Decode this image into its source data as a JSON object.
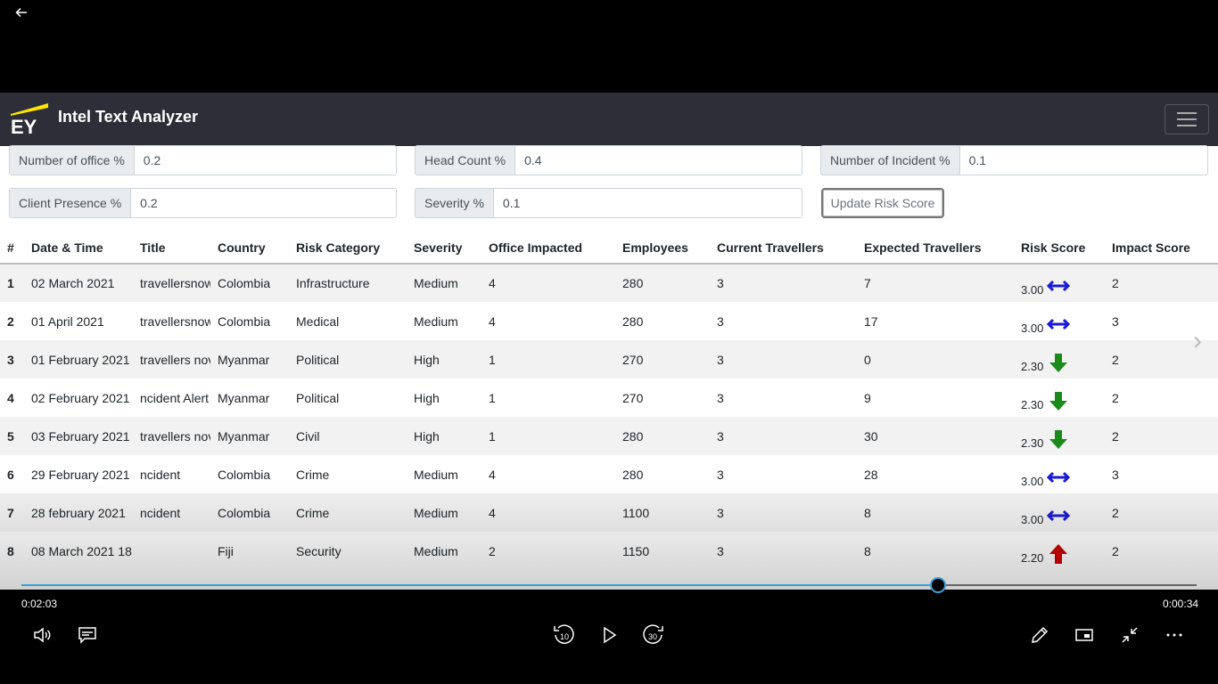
{
  "player": {
    "elapsed": "0:02:03",
    "remaining": "0:00:34",
    "progress_fraction": 0.78,
    "skip_back_label": "10",
    "skip_forward_label": "30"
  },
  "app": {
    "logo_text": "EY",
    "title": "Intel Text Analyzer"
  },
  "weights": [
    {
      "label": "Number of office %",
      "value": "0.2"
    },
    {
      "label": "Head Count %",
      "value": "0.4"
    },
    {
      "label": "Number of Incident %",
      "value": "0.1"
    },
    {
      "label": "Client Presence %",
      "value": "0.2"
    },
    {
      "label": "Severity %",
      "value": "0.1"
    }
  ],
  "update_button": "Update Risk Score",
  "table": {
    "headers": [
      "#",
      "Date & Time",
      "Title",
      "Country",
      "Risk Category",
      "Severity",
      "Office Impacted",
      "Employees",
      "Current Travellers",
      "Expected Travellers",
      "Risk Score",
      "Impact Score"
    ],
    "rows": [
      {
        "idx": "1",
        "date": "02 March 2021",
        "title": "travellersnow",
        "country": "Colombia",
        "category": "Infrastructure",
        "severity": "Medium",
        "office": "4",
        "employees": "280",
        "current": "3",
        "expected": "7",
        "risk": "3.00",
        "trend": "flat",
        "impact": "2"
      },
      {
        "idx": "2",
        "date": "01 April 2021",
        "title": "travellersnow",
        "country": "Colombia",
        "category": "Medical",
        "severity": "Medium",
        "office": "4",
        "employees": "280",
        "current": "3",
        "expected": "17",
        "risk": "3.00",
        "trend": "flat",
        "impact": "3"
      },
      {
        "idx": "3",
        "date": "01 February 2021",
        "title": "travellers nov",
        "country": "Myanmar",
        "category": "Political",
        "severity": "High",
        "office": "1",
        "employees": "270",
        "current": "3",
        "expected": "0",
        "risk": "2.30",
        "trend": "down",
        "impact": "2"
      },
      {
        "idx": "4",
        "date": "02 February 2021",
        "title": "ncident Alert",
        "country": "Myanmar",
        "category": "Political",
        "severity": "High",
        "office": "1",
        "employees": "270",
        "current": "3",
        "expected": "9",
        "risk": "2.30",
        "trend": "down",
        "impact": "2"
      },
      {
        "idx": "5",
        "date": "03 February 2021 :",
        "title": "travellers nov",
        "country": "Myanmar",
        "category": "Civil",
        "severity": "High",
        "office": "1",
        "employees": "280",
        "current": "3",
        "expected": "30",
        "risk": "2.30",
        "trend": "down",
        "impact": "2"
      },
      {
        "idx": "6",
        "date": "29 February 2021",
        "title": "ncident",
        "country": "Colombia",
        "category": "Crime",
        "severity": "Medium",
        "office": "4",
        "employees": "280",
        "current": "3",
        "expected": "28",
        "risk": "3.00",
        "trend": "flat",
        "impact": "3"
      },
      {
        "idx": "7",
        "date": "28 february 2021",
        "title": "ncident",
        "country": "Colombia",
        "category": "Crime",
        "severity": "Medium",
        "office": "4",
        "employees": "1100",
        "current": "3",
        "expected": "8",
        "risk": "3.00",
        "trend": "flat",
        "impact": "2"
      },
      {
        "idx": "8",
        "date": "08 March 2021 18:",
        "title": "",
        "country": "Fiji",
        "category": "Security",
        "severity": "Medium",
        "office": "2",
        "employees": "1150",
        "current": "3",
        "expected": "8",
        "risk": "2.20",
        "trend": "up",
        "impact": "2"
      }
    ]
  },
  "colors": {
    "navbar": "#2e2e38",
    "logo_yellow": "#ffe600",
    "trend_flat": "#1a1ad6",
    "trend_down": "#1a8a1a",
    "trend_up": "#cc0000",
    "seek": "#3aa0d8"
  },
  "icons": {
    "back": "arrow-left-icon",
    "menu": "hamburger-icon",
    "next": "chevron-right-icon",
    "volume": "volume-icon",
    "captions": "captions-icon",
    "rewind": "skip-back-10-icon",
    "play": "play-icon",
    "forward": "skip-forward-30-icon",
    "edit": "pencil-icon",
    "miniplayer": "miniplayer-icon",
    "exit_fullscreen": "exit-fullscreen-icon",
    "more": "more-icon"
  }
}
